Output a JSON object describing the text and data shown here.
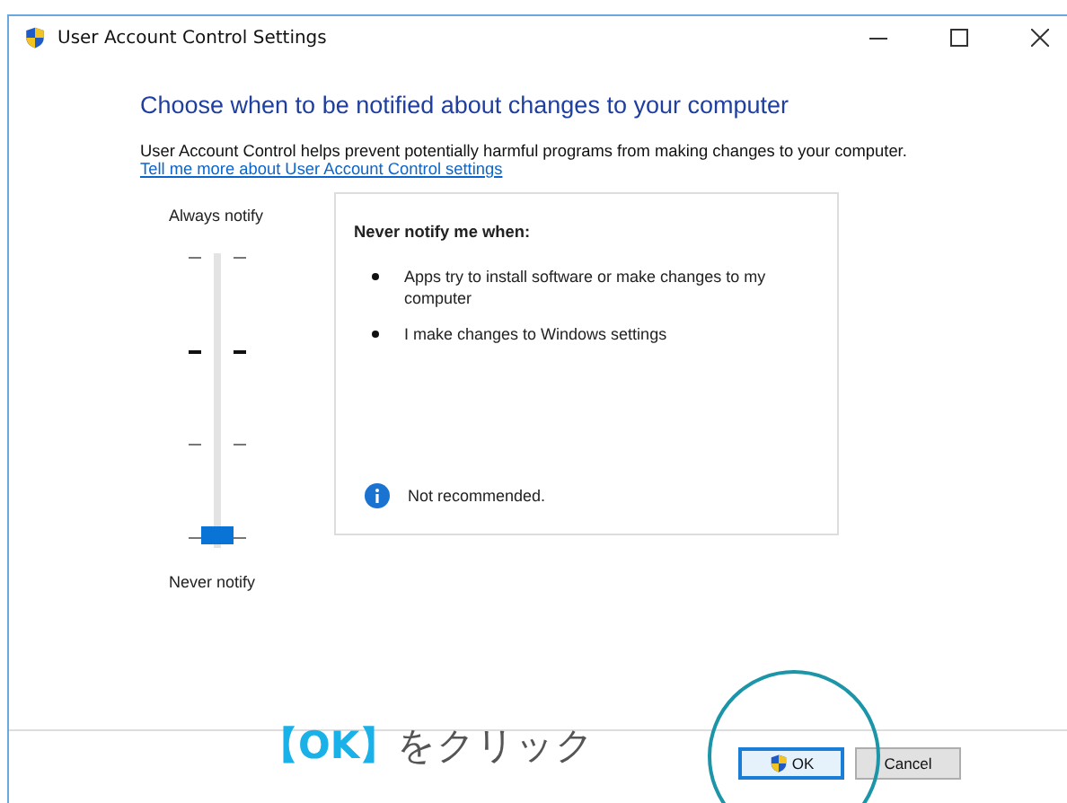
{
  "window": {
    "title": "User Account Control Settings"
  },
  "heading": "Choose when to be notified about changes to your computer",
  "description": "User Account Control helps prevent potentially harmful programs from making changes to your computer.",
  "link": "Tell me more about User Account Control settings",
  "slider": {
    "top_label": "Always notify",
    "bottom_label": "Never notify",
    "level": 0
  },
  "info_box": {
    "title": "Never notify me when:",
    "bullets": [
      "Apps try to install software or make changes to my computer",
      "I make changes to Windows settings"
    ],
    "note": "Not recommended."
  },
  "buttons": [
    {
      "label": "OK",
      "kind": "shield",
      "focused": true
    },
    {
      "label": "Cancel",
      "kind": "plain",
      "focused": false
    }
  ],
  "annotation": {
    "text": "**【OK】**をクリック"
  }
}
